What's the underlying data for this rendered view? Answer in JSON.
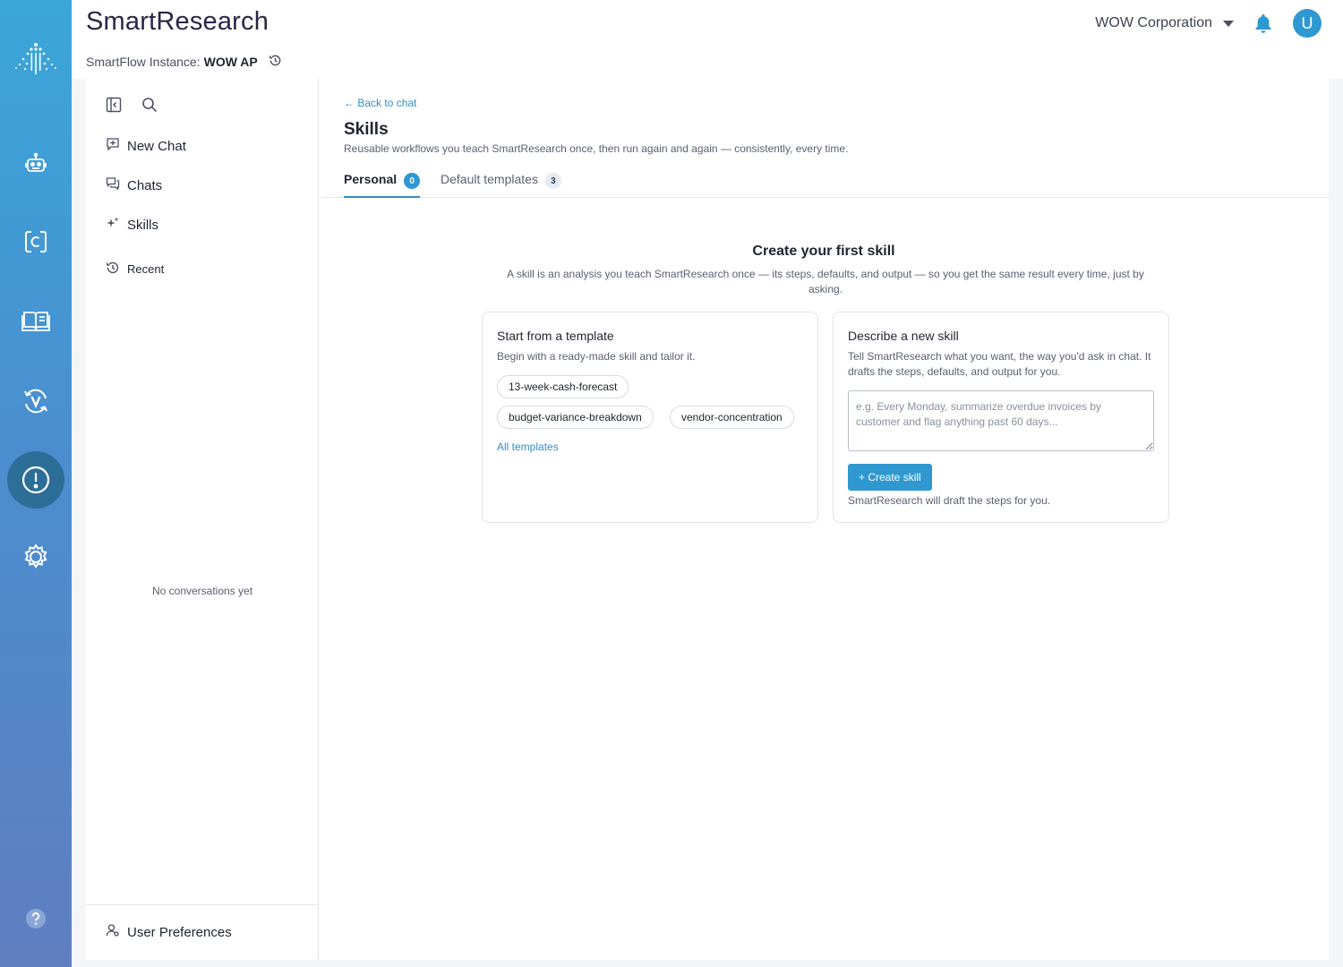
{
  "header": {
    "app_title": "SmartResearch",
    "instance_label": "SmartFlow Instance:",
    "instance_name": "WOW AP",
    "org_name": "WOW Corporation",
    "avatar_initial": "U"
  },
  "rail": {
    "icons": [
      "logo-icon",
      "robot-icon",
      "connector-icon",
      "book-icon",
      "refresh-v-icon",
      "alert-icon",
      "gear-icon",
      "help-icon"
    ],
    "active": "alert-icon"
  },
  "sidebar": {
    "new_chat": "New Chat",
    "chats": "Chats",
    "skills": "Skills",
    "recent": "Recent",
    "empty": "No conversations yet",
    "user_preferences": "User Preferences"
  },
  "main": {
    "back": "← Back to chat",
    "title": "Skills",
    "subtitle": "Reusable workflows you teach SmartResearch once, then run again and again — consistently, every time.",
    "tabs": [
      {
        "label": "Personal",
        "count": "0"
      },
      {
        "label": "Default templates",
        "count": "3"
      }
    ],
    "empty_title": "Create your first skill",
    "empty_subtitle": "A skill is an analysis you teach SmartResearch once — its steps, defaults, and output — so you get the same result every time, just by asking.",
    "template_card": {
      "title": "Start from a template",
      "description": "Begin with a ready-made skill and tailor it.",
      "chips": [
        "13-week-cash-forecast",
        "budget-variance-breakdown",
        "vendor-concentration"
      ],
      "link": "All templates"
    },
    "describe_card": {
      "title": "Describe a new skill",
      "description": "Tell SmartResearch what you want, the way you'd ask in chat. It drafts the steps, defaults, and output for you.",
      "placeholder": "e.g. Every Monday, summarize overdue invoices by customer and flag anything past 60 days...",
      "button": "+ Create skill",
      "hint": "SmartResearch will draft the steps for you."
    }
  },
  "colors": {
    "accent": "#2f98d0",
    "rail_top": "#3aa6d9",
    "rail_bottom": "#5f7ec0",
    "rail_active": "#2d6e99"
  }
}
